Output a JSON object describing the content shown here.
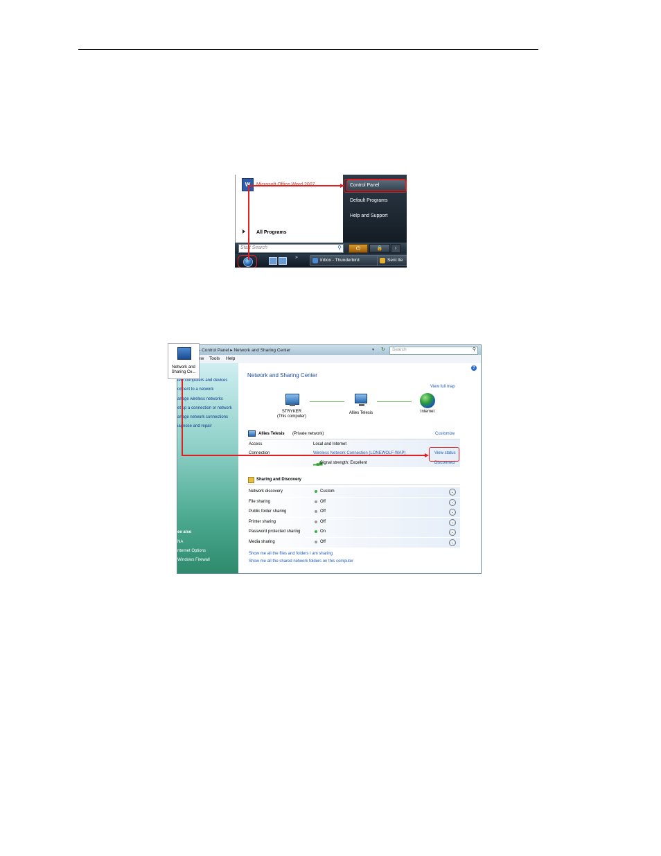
{
  "start_menu": {
    "word_item": "Microsoft Office Word 2007",
    "all_programs": "All Programs",
    "right_items": [
      "Control Panel",
      "Default Programs",
      "Help and Support"
    ],
    "search_placeholder": "Start Search",
    "taskbar_items": [
      "Inbox - Thunderbird",
      "Sent Ite"
    ],
    "quick_launch_more": "»"
  },
  "control_panel": {
    "breadcrumb": "▸  Control Panel  ▸  Network and Sharing Center",
    "search_placeholder": "Search",
    "menu": [
      "ew",
      "Tools",
      "Help"
    ],
    "sidebar_tasks": [
      "iew computers and devices",
      "onnect to a network",
      "anage wireless networks",
      "et up a connection or network",
      "anage network connections",
      "iagnose and repair"
    ],
    "see_also_title": "ee also",
    "see_also_items": [
      "NA",
      "nternet Options",
      "Windows Firewall"
    ],
    "title": "Network and Sharing Center",
    "view_full_map": "View full map",
    "map": {
      "computer_name": "STRYKER",
      "computer_sub": "(This computer)",
      "network_name": "Allies Telesis",
      "internet": "Internet"
    },
    "network": {
      "name": "Allies Telesis",
      "type": "(Private network)",
      "customize": "Customize",
      "access_label": "Access",
      "access_value": "Local and Internet",
      "connection_label": "Connection",
      "connection_value": "Wireless Network Connection (LONEWOLF-WAP)",
      "signal_value": "Signal strength:  Excellent",
      "view_status": "View status",
      "disconnect": "Disconnect"
    },
    "sharing_title": "Sharing and Discovery",
    "sharing_rows": [
      {
        "label": "Network discovery",
        "value": "Custom",
        "color": "#3cb043"
      },
      {
        "label": "File sharing",
        "value": "Off",
        "color": "#9a9a9a"
      },
      {
        "label": "Public folder sharing",
        "value": "Off",
        "color": "#9a9a9a"
      },
      {
        "label": "Printer sharing",
        "value": "Off",
        "color": "#9a9a9a"
      },
      {
        "label": "Password protected sharing",
        "value": "On",
        "color": "#3cb043"
      },
      {
        "label": "Media sharing",
        "value": "Off",
        "color": "#9a9a9a"
      }
    ],
    "footer_links": [
      "Show me all the files and folders I am sharing",
      "Show me all the shared network folders on this computer"
    ]
  },
  "desktop_icon": {
    "label_line1": "Network and",
    "label_line2": "Sharing Ce..."
  }
}
